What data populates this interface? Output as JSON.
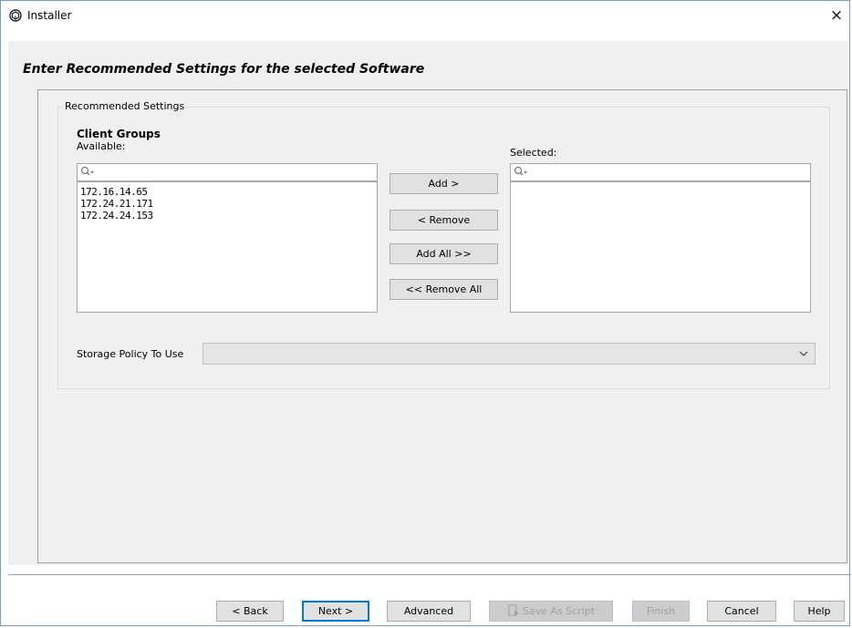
{
  "window": {
    "title": "Installer",
    "close_glyph": "×"
  },
  "heading": "Enter Recommended Settings for the selected Software",
  "recommended": {
    "legend": "Recommended Settings",
    "client_groups_label": "Client Groups",
    "available_label": "Available:",
    "selected_label": "Selected:",
    "available_items": [
      "172.16.14.65",
      "172.24.21.171",
      "172.24.24.153"
    ],
    "selected_items": [],
    "buttons": {
      "add": "Add >",
      "remove": "< Remove",
      "add_all": "Add All >>",
      "remove_all": "<< Remove All"
    },
    "storage_policy_label": "Storage Policy To Use",
    "storage_policy_value": ""
  },
  "footer": {
    "back": "< Back",
    "next": "Next >",
    "advanced": "Advanced",
    "save_as_script": "Save As Script",
    "finish": "Finish",
    "cancel": "Cancel",
    "help": "Help"
  }
}
